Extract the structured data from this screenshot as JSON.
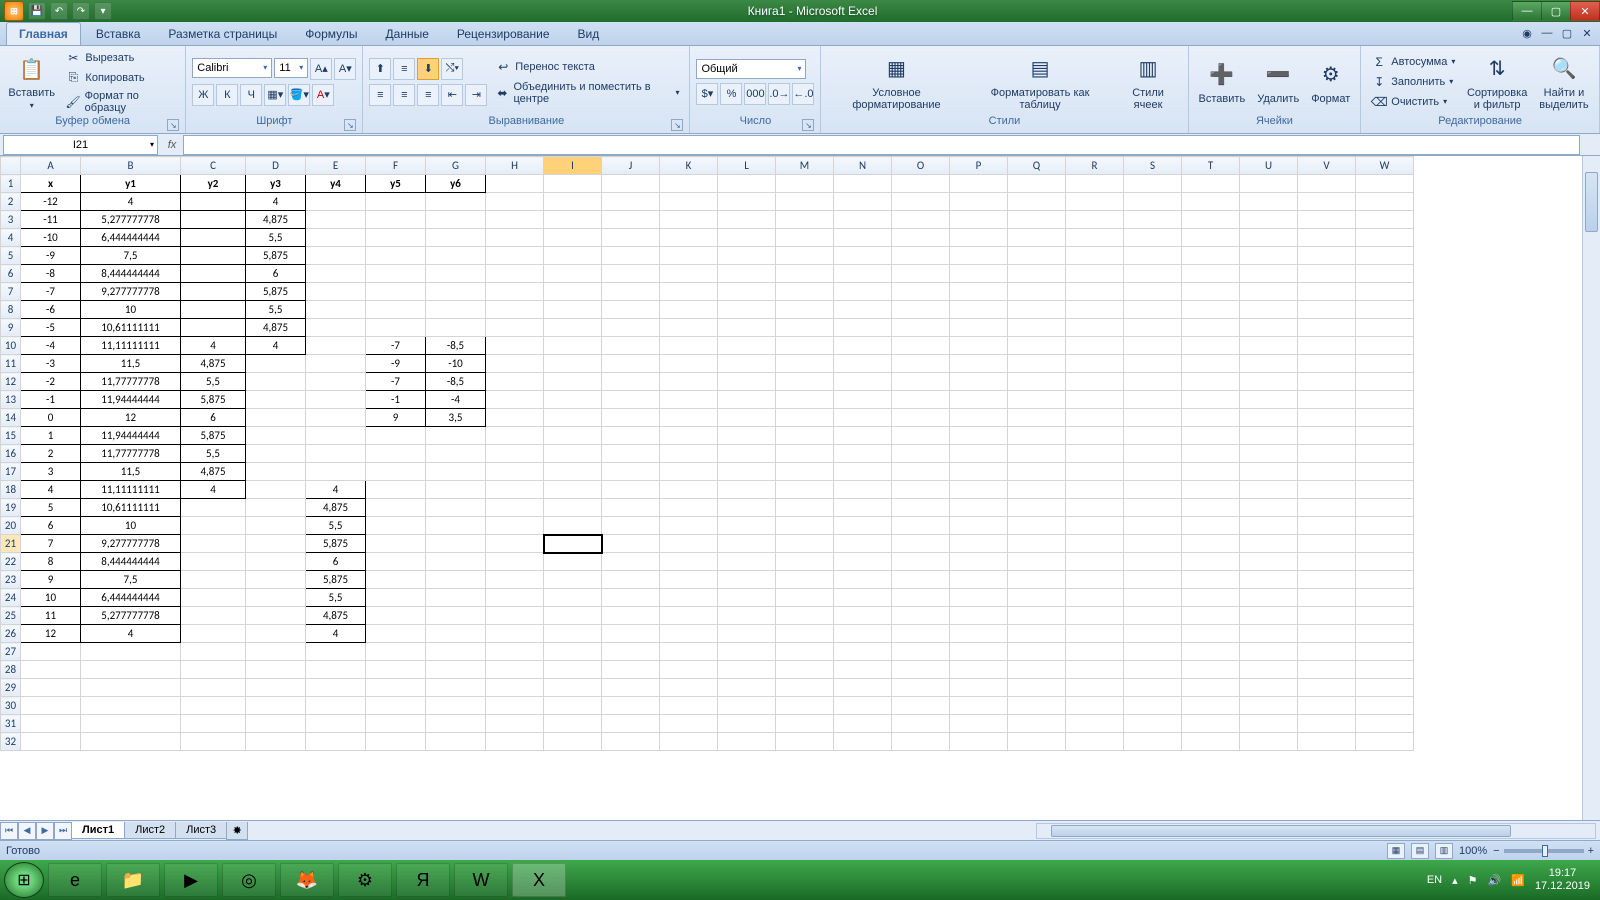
{
  "titlebar": {
    "title": "Книга1 - Microsoft Excel"
  },
  "ribbon_tabs": [
    "Главная",
    "Вставка",
    "Разметка страницы",
    "Формулы",
    "Данные",
    "Рецензирование",
    "Вид"
  ],
  "clipboard": {
    "paste": "Вставить",
    "cut": "Вырезать",
    "copy": "Копировать",
    "format": "Формат по образцу",
    "label": "Буфер обмена"
  },
  "font": {
    "name": "Calibri",
    "size": "11",
    "bold": "Ж",
    "italic": "К",
    "underline": "Ч",
    "label": "Шрифт"
  },
  "align": {
    "wrap": "Перенос текста",
    "merge": "Объединить и поместить в центре",
    "label": "Выравнивание"
  },
  "number": {
    "format": "Общий",
    "label": "Число"
  },
  "styles": {
    "cond": "Условное форматирование",
    "table": "Форматировать как таблицу",
    "cell": "Стили ячеек",
    "label": "Стили"
  },
  "cells": {
    "insert": "Вставить",
    "delete": "Удалить",
    "format": "Формат",
    "label": "Ячейки"
  },
  "editing": {
    "sum": "Автосумма",
    "fill": "Заполнить",
    "clear": "Очистить",
    "sort": "Сортировка и фильтр",
    "find": "Найти и выделить",
    "label": "Редактирование"
  },
  "namebox": "I21",
  "columns": [
    "A",
    "B",
    "C",
    "D",
    "E",
    "F",
    "G",
    "H",
    "I",
    "J",
    "K",
    "L",
    "M",
    "N",
    "O",
    "P",
    "Q",
    "R",
    "S",
    "T",
    "U",
    "V",
    "W"
  ],
  "col_widths": {
    "A": 60,
    "B": 100,
    "C": 65,
    "D": 60,
    "E": 60,
    "F": 60,
    "G": 60
  },
  "selected_col": "I",
  "selected_row": 21,
  "rows": 32,
  "headers_row": {
    "A": "x",
    "B": "y1",
    "C": "y2",
    "D": "y3",
    "E": "y4",
    "F": "y5",
    "G": "y6"
  },
  "data": {
    "2": {
      "A": "-12",
      "B": "4",
      "D": "4"
    },
    "3": {
      "A": "-11",
      "B": "5,277777778",
      "D": "4,875"
    },
    "4": {
      "A": "-10",
      "B": "6,444444444",
      "D": "5,5"
    },
    "5": {
      "A": "-9",
      "B": "7,5",
      "D": "5,875"
    },
    "6": {
      "A": "-8",
      "B": "8,444444444",
      "D": "6"
    },
    "7": {
      "A": "-7",
      "B": "9,277777778",
      "D": "5,875"
    },
    "8": {
      "A": "-6",
      "B": "10",
      "D": "5,5"
    },
    "9": {
      "A": "-5",
      "B": "10,61111111",
      "D": "4,875"
    },
    "10": {
      "A": "-4",
      "B": "11,11111111",
      "C": "4",
      "D": "4",
      "F": "-7",
      "G": "-8,5"
    },
    "11": {
      "A": "-3",
      "B": "11,5",
      "C": "4,875",
      "F": "-9",
      "G": "-10"
    },
    "12": {
      "A": "-2",
      "B": "11,77777778",
      "C": "5,5",
      "F": "-7",
      "G": "-8,5"
    },
    "13": {
      "A": "-1",
      "B": "11,94444444",
      "C": "5,875",
      "F": "-1",
      "G": "-4"
    },
    "14": {
      "A": "0",
      "B": "12",
      "C": "6",
      "F": "9",
      "G": "3,5"
    },
    "15": {
      "A": "1",
      "B": "11,94444444",
      "C": "5,875"
    },
    "16": {
      "A": "2",
      "B": "11,77777778",
      "C": "5,5"
    },
    "17": {
      "A": "3",
      "B": "11,5",
      "C": "4,875"
    },
    "18": {
      "A": "4",
      "B": "11,11111111",
      "C": "4",
      "E": "4"
    },
    "19": {
      "A": "5",
      "B": "10,61111111",
      "E": "4,875"
    },
    "20": {
      "A": "6",
      "B": "10",
      "E": "5,5"
    },
    "21": {
      "A": "7",
      "B": "9,277777778",
      "E": "5,875"
    },
    "22": {
      "A": "8",
      "B": "8,444444444",
      "E": "6"
    },
    "23": {
      "A": "9",
      "B": "7,5",
      "E": "5,875"
    },
    "24": {
      "A": "10",
      "B": "6,444444444",
      "E": "5,5"
    },
    "25": {
      "A": "11",
      "B": "5,277777778",
      "E": "4,875"
    },
    "26": {
      "A": "12",
      "B": "4",
      "E": "4"
    }
  },
  "bordered": {
    "A": [
      1,
      26
    ],
    "B": [
      1,
      26
    ],
    "C": [
      1,
      18
    ],
    "D": [
      1,
      10
    ],
    "E": [
      1,
      1
    ],
    "F": [
      1,
      1
    ],
    "G": [
      1,
      1
    ],
    "E2": [
      18,
      26
    ],
    "F2": [
      10,
      14
    ],
    "G2": [
      10,
      14
    ]
  },
  "sheets": [
    "Лист1",
    "Лист2",
    "Лист3"
  ],
  "status": {
    "ready": "Готово",
    "zoom": "100%"
  },
  "tray": {
    "lang": "EN",
    "time": "19:17",
    "date": "17.12.2019"
  }
}
